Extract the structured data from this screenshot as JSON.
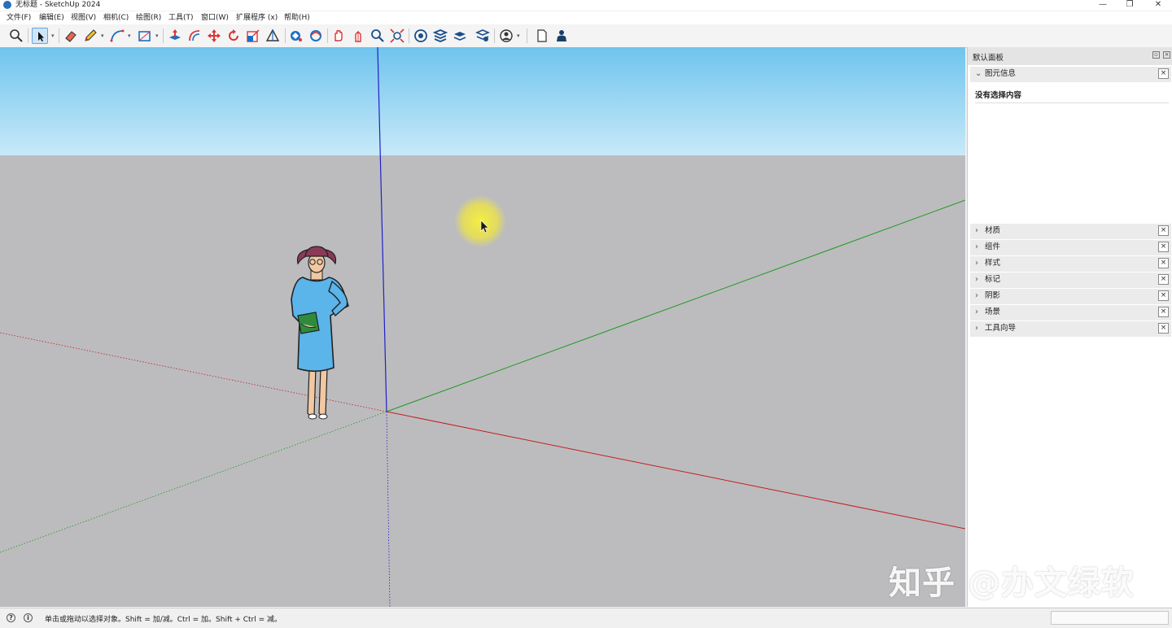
{
  "app": {
    "window_title": "无标题 - SketchUp 2024",
    "window_controls": {
      "minimize": "—",
      "maximize": "❐",
      "close": "✕"
    }
  },
  "menu": {
    "items": [
      {
        "label": "文件(F)"
      },
      {
        "label": "编辑(E)"
      },
      {
        "label": "视图(V)"
      },
      {
        "label": "相机(C)"
      },
      {
        "label": "绘图(R)"
      },
      {
        "label": "工具(T)"
      },
      {
        "label": "窗口(W)"
      },
      {
        "label": "扩展程序 (x)"
      },
      {
        "label": "帮助(H)"
      }
    ]
  },
  "toolbar": {
    "tools": [
      {
        "name": "search-tool",
        "icon": "magnifier-icon"
      },
      {
        "name": "select-tool",
        "icon": "arrow-icon",
        "active": true
      },
      {
        "name": "eraser-tool",
        "icon": "eraser-icon"
      },
      {
        "name": "pencil-tool",
        "icon": "pencil-icon"
      },
      {
        "name": "arc-tool",
        "icon": "arc-icon"
      },
      {
        "name": "shape-tool",
        "icon": "rectangle-icon"
      },
      {
        "name": "push-pull-tool",
        "icon": "push-pull-icon"
      },
      {
        "name": "offset-tool",
        "icon": "offset-icon"
      },
      {
        "name": "move-tool",
        "icon": "move-icon"
      },
      {
        "name": "rotate-tool",
        "icon": "rotate-icon"
      },
      {
        "name": "scale-tool",
        "icon": "scale-icon"
      },
      {
        "name": "tape-measure-tool",
        "icon": "tape-icon"
      },
      {
        "name": "paint-bucket-tool",
        "icon": "paint-bucket-icon"
      },
      {
        "name": "orbit-tool",
        "icon": "orbit-icon"
      },
      {
        "name": "pan-tool",
        "icon": "pan-icon"
      },
      {
        "name": "zoom-tool",
        "icon": "zoom-icon"
      },
      {
        "name": "zoom-extents-tool",
        "icon": "zoom-extents-icon"
      },
      {
        "name": "warehouse-tool",
        "icon": "warehouse-icon"
      },
      {
        "name": "extension-warehouse-tool",
        "icon": "extension-icon"
      },
      {
        "name": "layout-tool",
        "icon": "layout-icon"
      },
      {
        "name": "account-tool",
        "icon": "account-icon"
      },
      {
        "name": "new-file-tool",
        "icon": "document-icon"
      },
      {
        "name": "profile-tool",
        "icon": "person-icon"
      }
    ]
  },
  "panel": {
    "title": "默认面板",
    "entity_info": {
      "label": "图元信息",
      "content": "没有选择内容"
    },
    "trays": [
      {
        "label": "材质"
      },
      {
        "label": "组件"
      },
      {
        "label": "样式"
      },
      {
        "label": "标记"
      },
      {
        "label": "阴影"
      },
      {
        "label": "场景"
      },
      {
        "label": "工具向导"
      }
    ],
    "close_glyph": "×"
  },
  "status": {
    "text": "单击或拖动以选择对象。Shift = 加/减。Ctrl = 加。Shift + Ctrl = 减。",
    "icon1": "?",
    "icon2": "i"
  },
  "watermark": "知乎 @办文绿软",
  "colors": {
    "sky_top": "#6fc4ee",
    "sky_bottom": "#c8e9f8",
    "ground": "#bcbcbf",
    "axis_red": "#c41e1e",
    "axis_green": "#1e9a1e",
    "axis_blue": "#2020c8",
    "highlight": "#f5ee3a",
    "dress": "#5bb4ea",
    "hat": "#8a3a55"
  }
}
